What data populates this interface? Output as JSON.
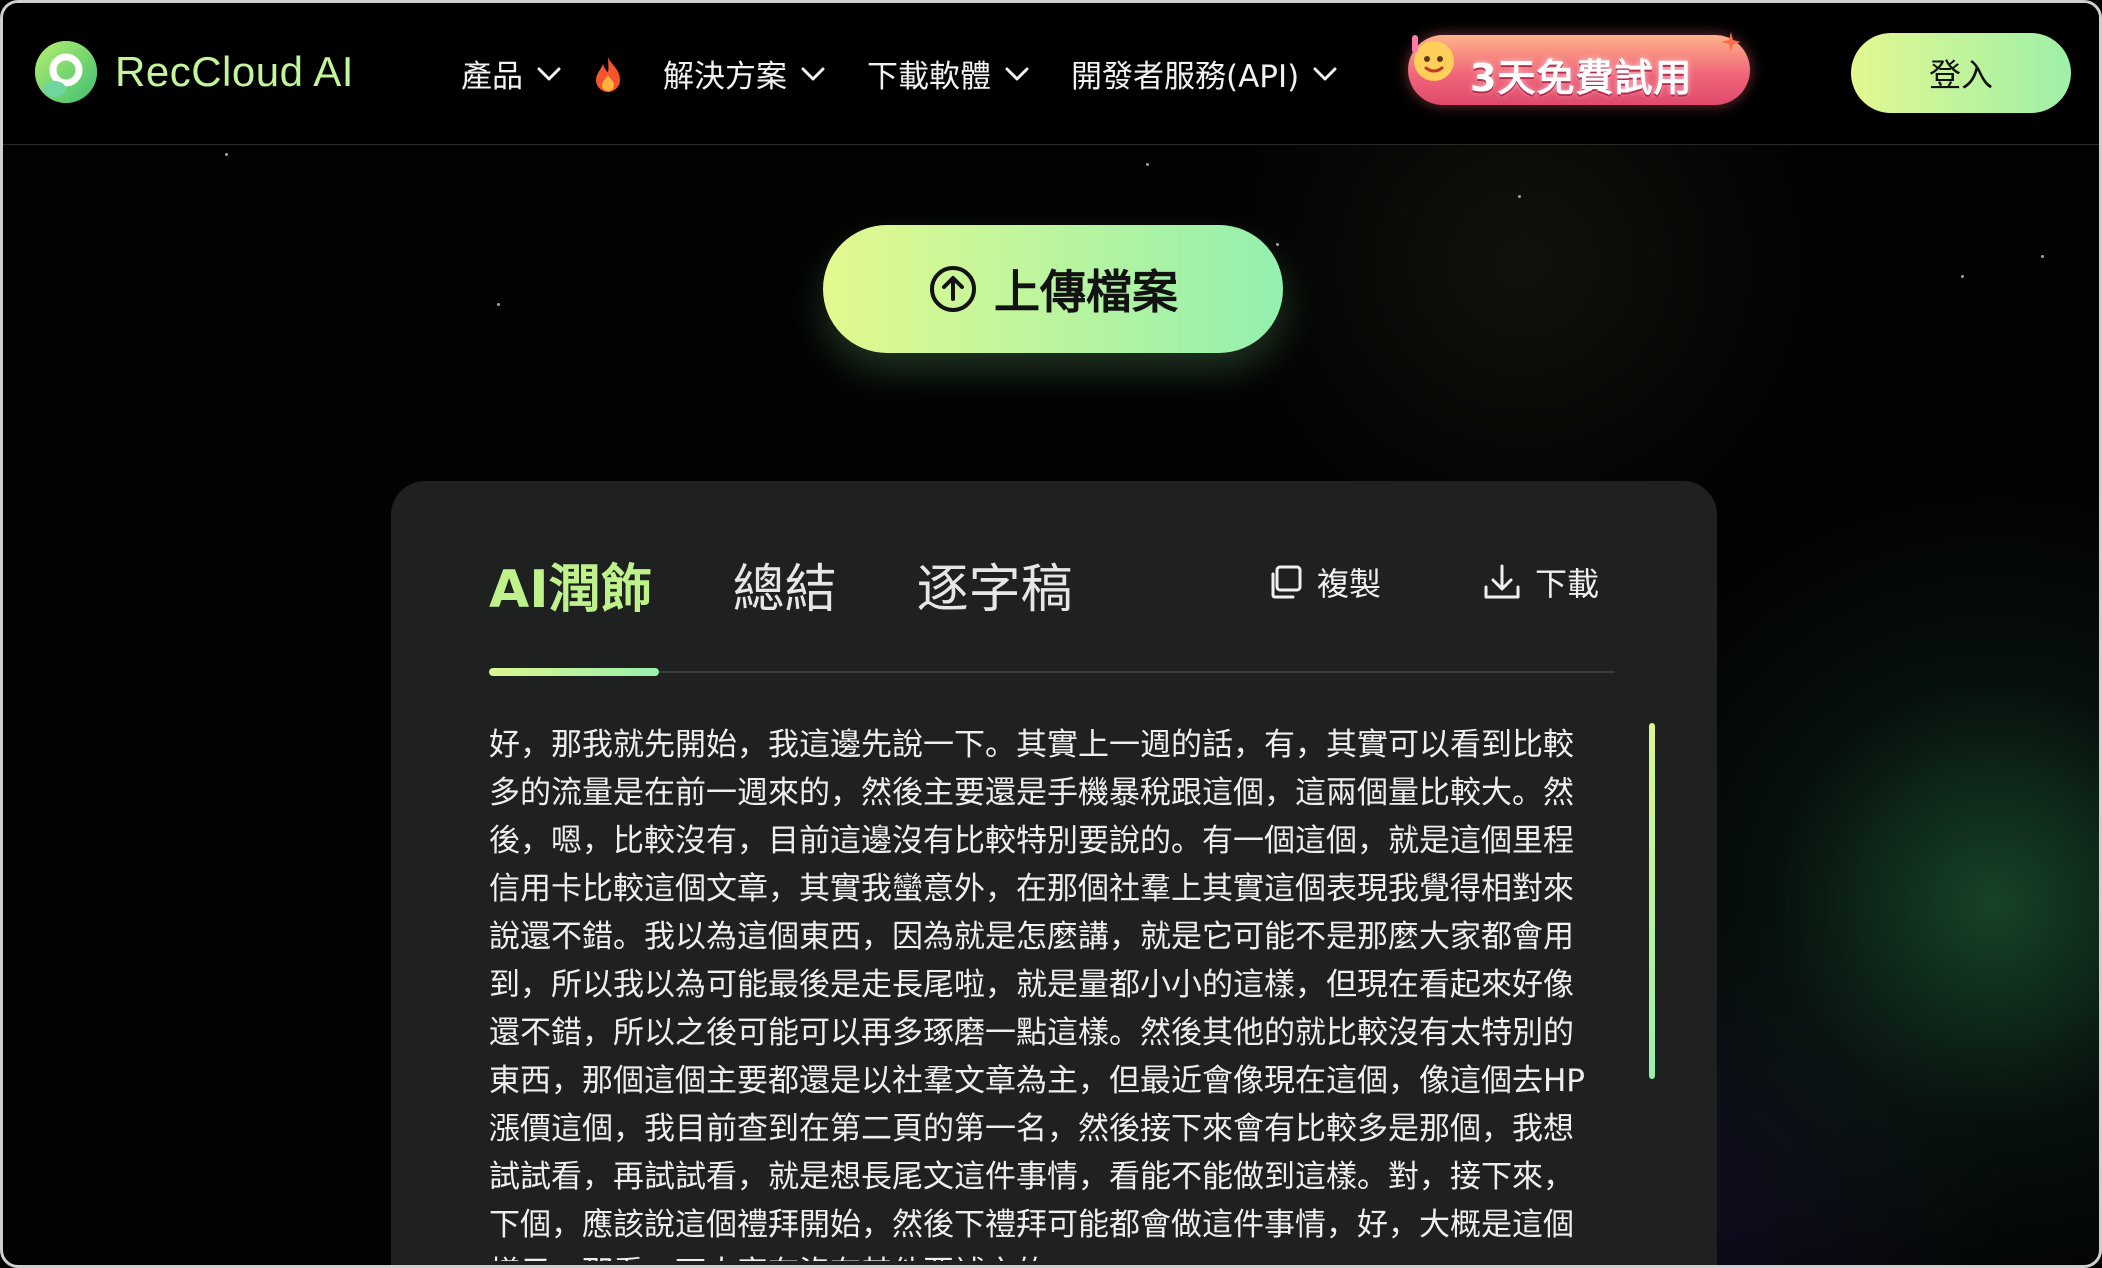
{
  "brand": {
    "name": "RecCloud AI"
  },
  "nav": {
    "items": [
      {
        "label": "產品"
      },
      {
        "label": "解決方案"
      },
      {
        "label": "下載軟體"
      },
      {
        "label": "開發者服務(API)"
      }
    ],
    "promo_label": "3天免費試用",
    "login_label": "登入"
  },
  "upload": {
    "label": "上傳檔案"
  },
  "card": {
    "tabs": [
      {
        "label": "AI潤飾",
        "active": true
      },
      {
        "label": "總結",
        "active": false
      },
      {
        "label": "逐字稿",
        "active": false
      }
    ],
    "copy_label": "複製",
    "download_label": "下載",
    "text": "好，那我就先開始，我這邊先說一下。其實上一週的話，有，其實可以看到比較多的流量是在前一週來的，然後主要還是手機暴稅跟這個，這兩個量比較大。然後，嗯，比較沒有，目前這邊沒有比較特別要說的。有一個這個，就是這個里程信用卡比較這個文章，其實我蠻意外，在那個社羣上其實這個表現我覺得相對來說還不錯。我以為這個東西，因為就是怎麼講，就是它可能不是那麼大家都會用到，所以我以為可能最後是走長尾啦，就是量都小小的這樣，但現在看起來好像還不錯，所以之後可能可以再多琢磨一點這樣。然後其他的就比較沒有太特別的東西，那個這個主要都還是以社羣文章為主，但最近會像現在這個，像這個去HP漲價這個，我目前查到在第二頁的第一名，然後接下來會有比較多是那個，我想試試看，再試試看，就是想長尾文這件事情，看能不能做到這樣。對，接下來，下個，應該說這個禮拜開始，然後下禮拜可能都會做這件事情，好，大概是這個樣子，那看一下大家有沒有其他要補充的。"
  },
  "colors": {
    "accent_green": "#bff28a",
    "gradient_start": "#e3f98f",
    "gradient_end": "#93f0ae",
    "card_bg": "#1f2121",
    "promo_red": "#f0677a"
  },
  "icons": {
    "logo": "reccloud-logo-icon",
    "chevron": "chevron-down-icon",
    "fire": "fire-icon",
    "upload": "upload-arrow-icon",
    "copy": "copy-icon",
    "download": "download-icon"
  }
}
